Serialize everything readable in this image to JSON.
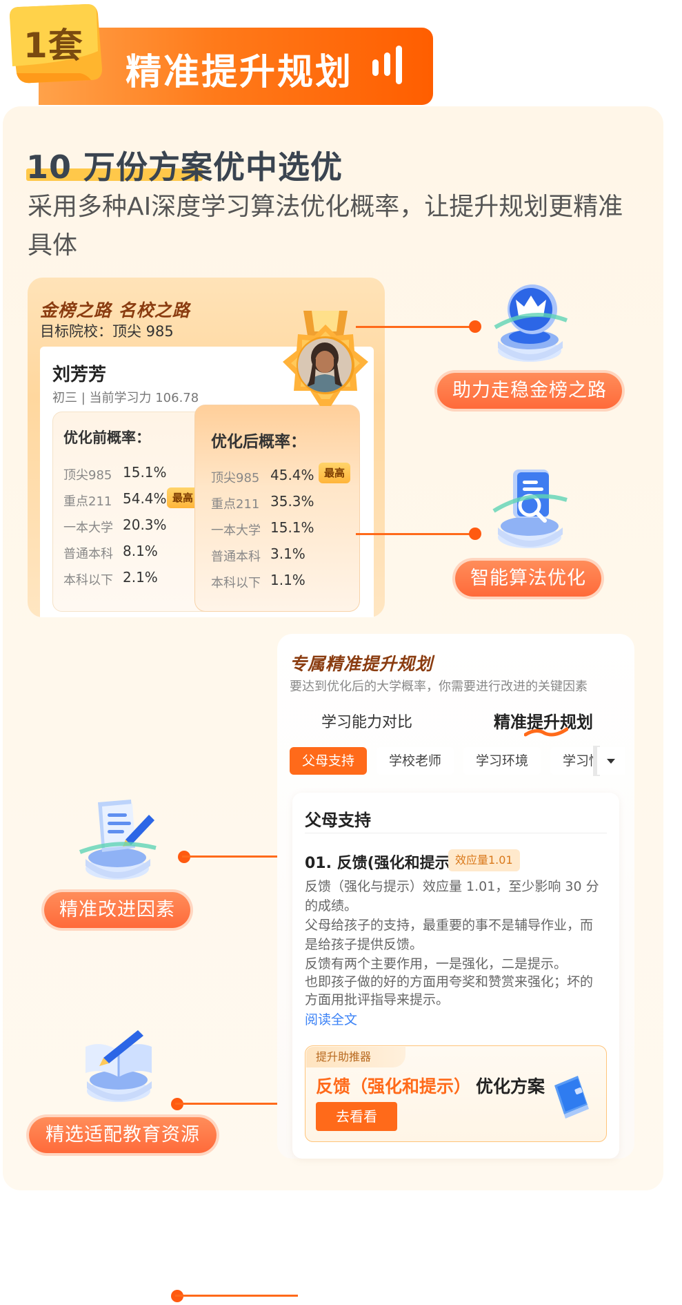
{
  "header": {
    "badge": "1套",
    "title": "精准提升规划"
  },
  "headline": {
    "title": "10 万份方案优中选优",
    "subtitle": "采用多种AI深度学习算法优化概率，让提升规划更精准具体"
  },
  "prob_card": {
    "slogan": "金榜之路 名校之路",
    "target": "目标院校：顶尖 985",
    "student": {
      "name": "刘芳芳",
      "info": "初三 | 当前学习力 106.78"
    },
    "before": {
      "title": "优化前概率：",
      "rows": [
        {
          "label": "顶尖985",
          "value": "15.1%"
        },
        {
          "label": "重点211",
          "value": "54.4%"
        },
        {
          "label": "一本大学",
          "value": "20.3%"
        },
        {
          "label": "普通本科",
          "value": "8.1%"
        },
        {
          "label": "本科以下",
          "value": "2.1%"
        }
      ],
      "best_tag": "最高"
    },
    "after": {
      "title": "优化后概率：",
      "rows": [
        {
          "label": "顶尖985",
          "value": "45.4%"
        },
        {
          "label": "重点211",
          "value": "35.3%"
        },
        {
          "label": "一本大学",
          "value": "15.1%"
        },
        {
          "label": "普通本科",
          "value": "3.1%"
        },
        {
          "label": "本科以下",
          "value": "1.1%"
        }
      ],
      "best_tag": "最高"
    }
  },
  "features": [
    {
      "label": "助力走稳金榜之路",
      "icon": "crown-icon"
    },
    {
      "label": "智能算法优化",
      "icon": "document-search-icon"
    },
    {
      "label": "精准改进因素",
      "icon": "document-pen-icon"
    },
    {
      "label": "精选适配教育资源",
      "icon": "book-pencil-icon"
    }
  ],
  "plan": {
    "title": "专属精准提升规划",
    "subtitle": "要达到优化后的大学概率，你需要进行改进的关键因素",
    "tabs": [
      "学习能力对比",
      "精准提升规划"
    ],
    "chips": [
      "父母支持",
      "学校老师",
      "学习环境",
      "学习情"
    ],
    "detail": {
      "heading": "父母支持",
      "factor_title": "01. 反馈(强化和提示)",
      "effect_badge": "效应量1.01",
      "lines": [
        "反馈（强化与提示）效应量 1.01，至少影响 30 分",
        "的成绩。",
        "父母给孩子的支持，最重要的事不是辅导作业，而",
        "是给孩子提供反馈。",
        "反馈有两个主要作用，一是强化，二是提示。",
        "也即孩子做的好的方面用夸奖和赞赏来强化；坏的",
        "方面用批评指导来提示。"
      ],
      "read_more": "阅读全文"
    },
    "booster": {
      "tag": "提升助推器",
      "name": "反馈（强化和提示）",
      "plan": "优化方案",
      "button": "去看看"
    }
  },
  "colors": {
    "accent": "#ff6a1a",
    "panel": "#fff6e8",
    "brown": "#8a3c10",
    "link": "#3b82f6"
  }
}
